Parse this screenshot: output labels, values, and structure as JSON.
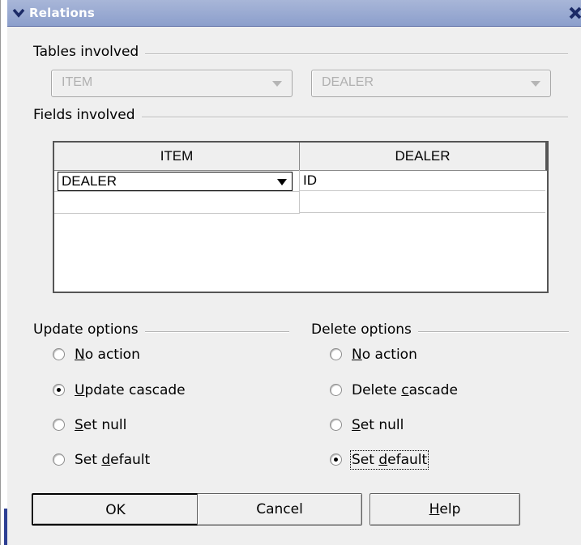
{
  "window": {
    "title": "Relations"
  },
  "tables_group": {
    "label": "Tables involved",
    "left_table": "ITEM",
    "right_table": "DEALER"
  },
  "fields_group": {
    "label": "Fields involved",
    "columns": [
      "ITEM",
      "DEALER"
    ],
    "rows": [
      {
        "item": "DEALER",
        "dealer": "ID"
      }
    ]
  },
  "update_options": {
    "label": "Update options",
    "options": [
      {
        "pre": "",
        "u": "N",
        "post": "o action",
        "selected": false
      },
      {
        "pre": "",
        "u": "U",
        "post": "pdate cascade",
        "selected": true
      },
      {
        "pre": "",
        "u": "S",
        "post": "et null",
        "selected": false
      },
      {
        "pre": "Set ",
        "u": "d",
        "post": "efault",
        "selected": false
      }
    ]
  },
  "delete_options": {
    "label": "Delete options",
    "options": [
      {
        "pre": "",
        "u": "N",
        "post": "o action",
        "selected": false
      },
      {
        "pre": "Delete ",
        "u": "c",
        "post": "ascade",
        "selected": false
      },
      {
        "pre": "",
        "u": "S",
        "post": "et null",
        "selected": false
      },
      {
        "pre": "Set ",
        "u": "d",
        "post": "efault",
        "selected": true
      }
    ]
  },
  "buttons": {
    "ok": "OK",
    "cancel": "Cancel",
    "help_u": "H",
    "help_post": "elp"
  }
}
